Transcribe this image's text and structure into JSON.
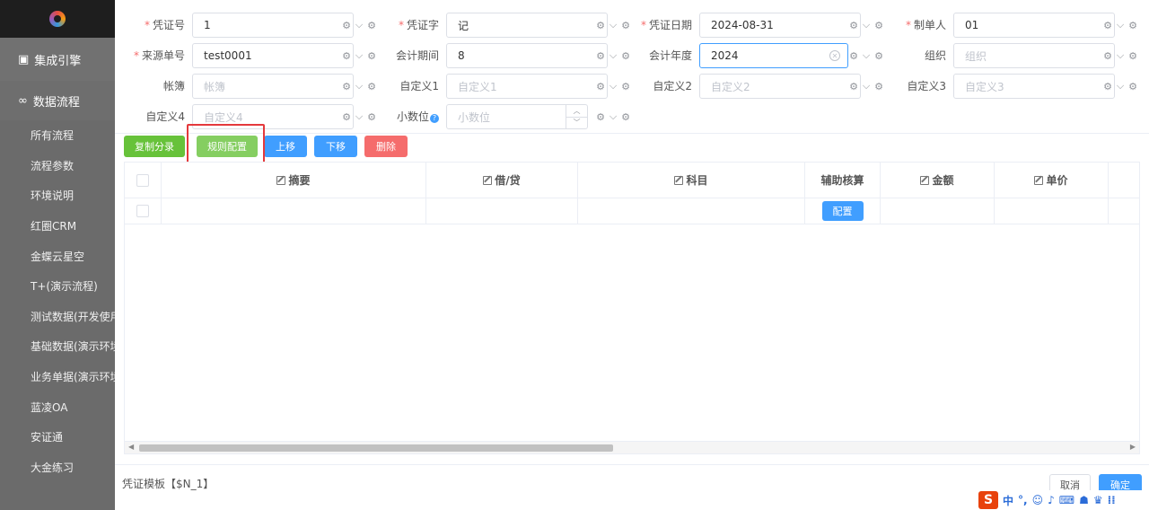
{
  "sidebar": {
    "groups": [
      {
        "icon": "integration-icon",
        "label": "集成引擎"
      },
      {
        "icon": "infinity-icon",
        "label": "数据流程"
      }
    ],
    "items": [
      "所有流程",
      "流程参数",
      "环境说明",
      "红圈CRM",
      "金蝶云星空",
      "T+(演示流程)",
      "测试数据(开发使用",
      "基础数据(演示环境",
      "业务单据(演示环境",
      "蓝凌OA",
      "安证通",
      "大金练习"
    ]
  },
  "form": {
    "voucher_no": {
      "label": "凭证号",
      "required": true,
      "value": "1"
    },
    "voucher_word": {
      "label": "凭证字",
      "required": true,
      "value": "记"
    },
    "voucher_date": {
      "label": "凭证日期",
      "required": true,
      "value": "2024-08-31"
    },
    "maker": {
      "label": "制单人",
      "required": true,
      "value": "01"
    },
    "source_no": {
      "label": "来源单号",
      "required": true,
      "value": "test0001"
    },
    "period": {
      "label": "会计期间",
      "value": "8"
    },
    "year": {
      "label": "会计年度",
      "value": "2024"
    },
    "org": {
      "label": "组织",
      "placeholder": "组织"
    },
    "book": {
      "label": "帐簿",
      "placeholder": "帐簿"
    },
    "custom1": {
      "label": "自定义1",
      "placeholder": "自定义1"
    },
    "custom2": {
      "label": "自定义2",
      "placeholder": "自定义2"
    },
    "custom3": {
      "label": "自定义3",
      "placeholder": "自定义3"
    },
    "custom4": {
      "label": "自定义4",
      "placeholder": "自定义4"
    },
    "decimals": {
      "label": "小数位",
      "placeholder": "小数位"
    }
  },
  "toolbar": {
    "copy_entry": "复制分录",
    "rule_config": "规则配置",
    "move_up": "上移",
    "move_down": "下移",
    "delete": "删除"
  },
  "table": {
    "columns": [
      "摘要",
      "借/贷",
      "科目",
      "辅助核算",
      "金额",
      "单价"
    ],
    "row_button": "配置"
  },
  "footer": {
    "template": "凭证模板【$N_1】",
    "cancel": "取消",
    "ok": "确定"
  },
  "ime": {
    "lang": "中"
  }
}
